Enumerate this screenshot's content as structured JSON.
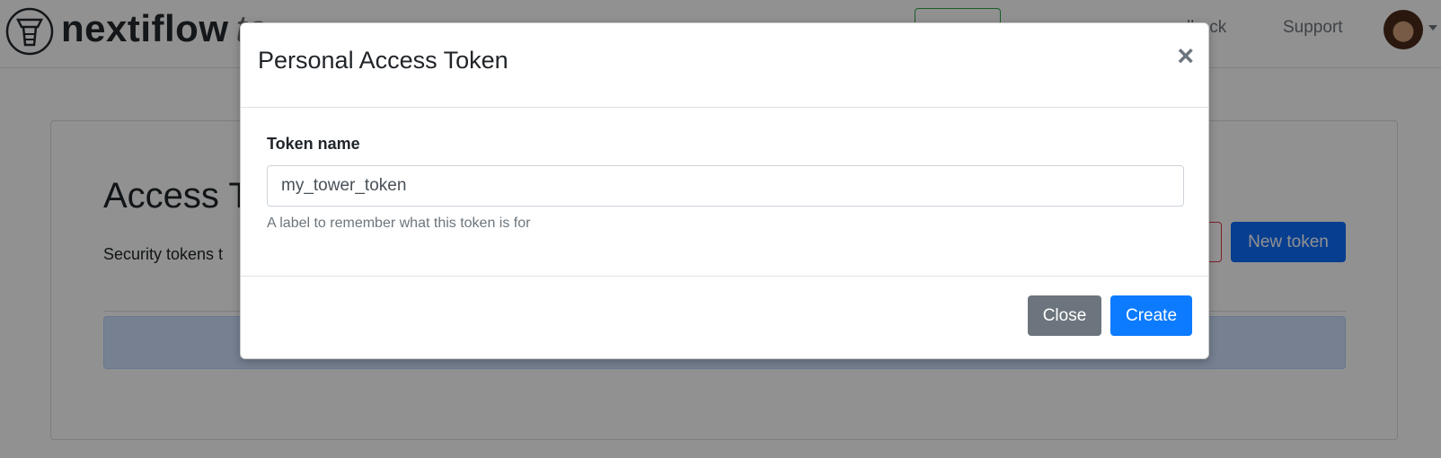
{
  "navbar": {
    "brand_name": "nextiflow",
    "brand_suffix": "to",
    "feedback_label": "edback",
    "support_label": "Support"
  },
  "page": {
    "title": "Access T",
    "description": "Security tokens t",
    "new_token_label": "New token"
  },
  "modal": {
    "title": "Personal Access Token",
    "close_icon": "×",
    "field_label": "Token name",
    "input_value": "my_tower_token",
    "help_text": "A label to remember what this token is for",
    "close_label": "Close",
    "create_label": "Create"
  }
}
